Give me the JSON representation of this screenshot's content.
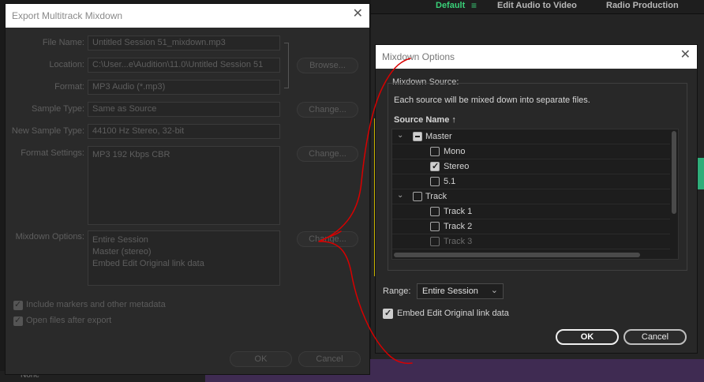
{
  "workspace_bar": {
    "items": [
      {
        "label": "Default",
        "active": true
      },
      {
        "label": "Edit Audio to Video",
        "active": false
      },
      {
        "label": "Radio Production",
        "active": false
      }
    ],
    "menu_glyph": "≡"
  },
  "background": {
    "bottom_left_text": "None"
  },
  "export_dialog": {
    "title": "Export Multitrack Mixdown",
    "close": "✕",
    "file_name_label": "File Name:",
    "file_name_value": "Untitled Session 51_mixdown.mp3",
    "location_label": "Location:",
    "location_value": "C:\\User...e\\Audition\\11.0\\Untitled Session 51",
    "format_label": "Format:",
    "format_value": "MP3 Audio (*.mp3)",
    "browse_label": "Browse...",
    "sample_type_label": "Sample Type:",
    "sample_type_value": "Same as Source",
    "new_sample_type_label": "New Sample Type:",
    "new_sample_type_value": "44100 Hz Stereo, 32-bit",
    "format_settings_label": "Format Settings:",
    "format_settings_value": "MP3 192 Kbps CBR",
    "change_label": "Change...",
    "mixdown_options_label": "Mixdown Options:",
    "mixdown_options_lines": [
      "Entire Session",
      "Master (stereo)",
      "Embed Edit Original link data"
    ],
    "include_markers_label": "Include markers and other metadata",
    "open_files_label": "Open files after export",
    "ok_label": "OK",
    "cancel_label": "Cancel"
  },
  "mixdown_dialog": {
    "title": "Mixdown Options",
    "close": "✕",
    "source_label": "Mixdown Source:",
    "note": "Each source will be mixed down into separate files.",
    "column_header": "Source Name",
    "sort_glyph": "↑",
    "tree": [
      {
        "label": "Master",
        "indent": 0,
        "expanded": true,
        "state": "mixed",
        "dim": false
      },
      {
        "label": "Mono",
        "indent": 1,
        "state": "unchecked",
        "dim": false
      },
      {
        "label": "Stereo",
        "indent": 1,
        "state": "checked",
        "dim": false
      },
      {
        "label": "5.1",
        "indent": 1,
        "state": "unchecked",
        "dim": false
      },
      {
        "label": "Track",
        "indent": 0,
        "expanded": true,
        "state": "unchecked",
        "dim": false
      },
      {
        "label": "Track 1",
        "indent": 1,
        "state": "unchecked",
        "dim": false
      },
      {
        "label": "Track 2",
        "indent": 1,
        "state": "unchecked",
        "dim": false
      },
      {
        "label": "Track 3",
        "indent": 1,
        "state": "unchecked",
        "dim": true
      }
    ],
    "range_label": "Range:",
    "range_value": "Entire Session",
    "embed_label": "Embed Edit Original link data",
    "embed_checked": true,
    "ok_label": "OK",
    "cancel_label": "Cancel"
  },
  "colors": {
    "accent_green": "#39d078",
    "annotation_red": "#d90000",
    "dialog_bg": "#282828",
    "title_bg": "#ffffff"
  }
}
